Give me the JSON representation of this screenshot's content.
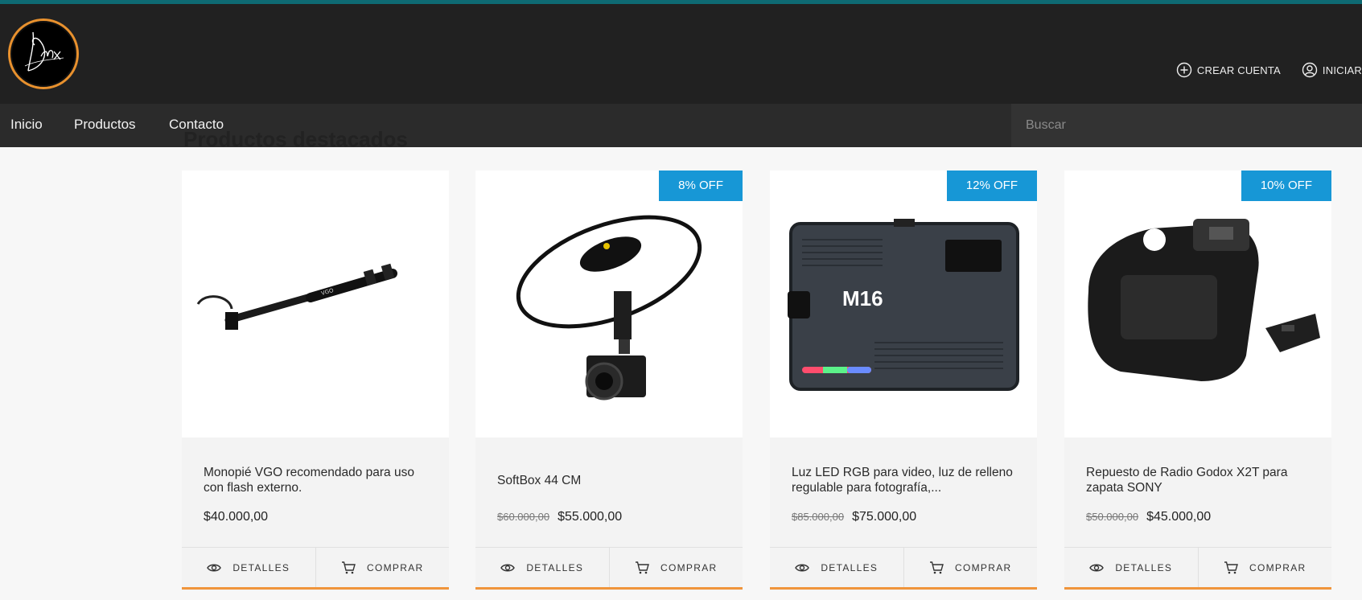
{
  "header": {
    "logo_text": "Dnx",
    "links": [
      {
        "label": "CREAR CUENTA",
        "icon": "plus-circle-icon"
      },
      {
        "label": "INICIAR",
        "icon": "user-circle-icon"
      }
    ]
  },
  "nav": {
    "items": [
      "Inicio",
      "Productos",
      "Contacto"
    ],
    "search_placeholder": "Buscar"
  },
  "section": {
    "title": "Productos destacados"
  },
  "colors": {
    "accent_orange": "#f0953b",
    "badge_blue": "#1797d6",
    "header_bg": "#212121",
    "top_strip": "#0e6a73"
  },
  "products": [
    {
      "title": "Monopié VGO recomendado para uso con flash externo.",
      "old_price": "",
      "price": "$40.000,00",
      "badge": "",
      "details_label": "DETALLES",
      "buy_label": "COMPRAR"
    },
    {
      "title": "SoftBox 44 CM",
      "old_price": "$60.000,00",
      "price": "$55.000,00",
      "badge": "8% OFF",
      "details_label": "DETALLES",
      "buy_label": "COMPRAR"
    },
    {
      "title": "Luz LED RGB para video, luz de relleno regulable para fotografía,...",
      "old_price": "$85.000,00",
      "price": "$75.000,00",
      "badge": "12% OFF",
      "details_label": "DETALLES",
      "buy_label": "COMPRAR",
      "image_text": "M16"
    },
    {
      "title": "Repuesto de Radio Godox X2T para zapata SONY",
      "old_price": "$50.000,00",
      "price": "$45.000,00",
      "badge": "10% OFF",
      "details_label": "DETALLES",
      "buy_label": "COMPRAR"
    }
  ]
}
